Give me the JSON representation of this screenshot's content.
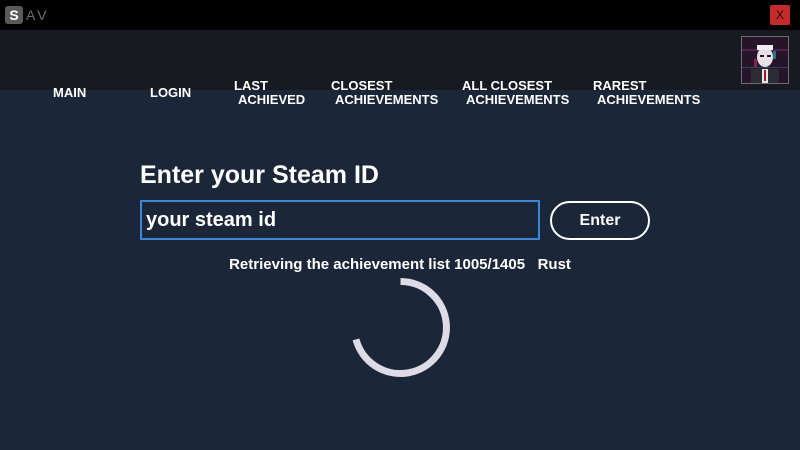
{
  "titlebar": {
    "logo_letter": "S",
    "logo_rest": "AV",
    "close_label": "X",
    "close_color": "#c42b2b"
  },
  "nav": {
    "items": [
      {
        "line1": "MAIN",
        "line2": ""
      },
      {
        "line1": "LOGIN",
        "line2": ""
      },
      {
        "line1": "LAST",
        "line2": "ACHIEVED"
      },
      {
        "line1": "CLOSEST",
        "line2": "ACHIEVEMENTS"
      },
      {
        "line1": "ALL CLOSEST",
        "line2": "ACHIEVEMENTS"
      },
      {
        "line1": "RAREST",
        "line2": "ACHIEVEMENTS"
      }
    ]
  },
  "main": {
    "heading": "Enter your Steam ID",
    "input_placeholder": "your steam id",
    "input_value": "",
    "enter_label": "Enter",
    "status_prefix": "Retrieving the achievement list",
    "progress_current": 1005,
    "progress_total": 1405,
    "progress_text": "1005/1405",
    "game_name": "Rust"
  },
  "colors": {
    "background": "#1b2738",
    "navbar": "#171a21",
    "titlebar": "#000000",
    "input_border": "#3b87d6",
    "spinner": "#dcdbe6"
  },
  "icons": {
    "close": "close-icon",
    "spinner": "loading-spinner-icon",
    "avatar": "user-avatar"
  }
}
